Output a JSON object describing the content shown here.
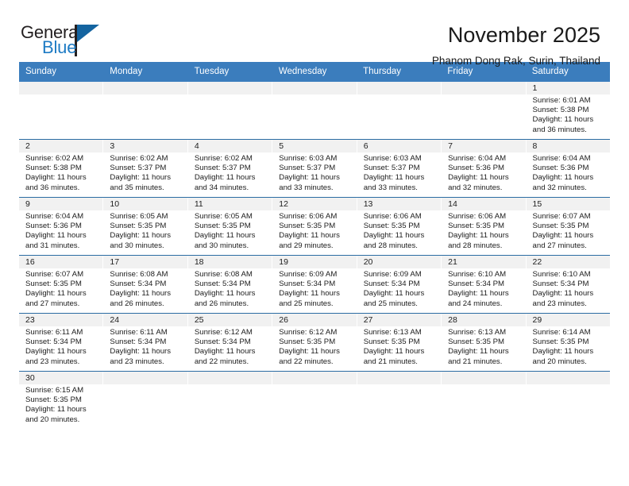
{
  "brand": {
    "name_top": "General",
    "name_bottom": "Blue",
    "accent_color": "#1e7bc4",
    "triangle_color": "#1464a0"
  },
  "header": {
    "title": "November 2025",
    "subtitle": "Phanom Dong Rak, Surin, Thailand"
  },
  "theme": {
    "header_row_bg": "#3b7dbd",
    "header_row_text": "#ffffff",
    "daynum_band_bg": "#f1f1f1",
    "week_divider": "#2b6ca3"
  },
  "weekdays": [
    "Sunday",
    "Monday",
    "Tuesday",
    "Wednesday",
    "Thursday",
    "Friday",
    "Saturday"
  ],
  "calendar_data": {
    "month": "November",
    "year": 2025,
    "location": "Phanom Dong Rak, Surin, Thailand",
    "weeks": [
      [
        {
          "day": ""
        },
        {
          "day": ""
        },
        {
          "day": ""
        },
        {
          "day": ""
        },
        {
          "day": ""
        },
        {
          "day": ""
        },
        {
          "day": "1",
          "sunrise": "Sunrise: 6:01 AM",
          "sunset": "Sunset: 5:38 PM",
          "daylight1": "Daylight: 11 hours",
          "daylight2": "and 36 minutes."
        }
      ],
      [
        {
          "day": "2",
          "sunrise": "Sunrise: 6:02 AM",
          "sunset": "Sunset: 5:38 PM",
          "daylight1": "Daylight: 11 hours",
          "daylight2": "and 36 minutes."
        },
        {
          "day": "3",
          "sunrise": "Sunrise: 6:02 AM",
          "sunset": "Sunset: 5:37 PM",
          "daylight1": "Daylight: 11 hours",
          "daylight2": "and 35 minutes."
        },
        {
          "day": "4",
          "sunrise": "Sunrise: 6:02 AM",
          "sunset": "Sunset: 5:37 PM",
          "daylight1": "Daylight: 11 hours",
          "daylight2": "and 34 minutes."
        },
        {
          "day": "5",
          "sunrise": "Sunrise: 6:03 AM",
          "sunset": "Sunset: 5:37 PM",
          "daylight1": "Daylight: 11 hours",
          "daylight2": "and 33 minutes."
        },
        {
          "day": "6",
          "sunrise": "Sunrise: 6:03 AM",
          "sunset": "Sunset: 5:37 PM",
          "daylight1": "Daylight: 11 hours",
          "daylight2": "and 33 minutes."
        },
        {
          "day": "7",
          "sunrise": "Sunrise: 6:04 AM",
          "sunset": "Sunset: 5:36 PM",
          "daylight1": "Daylight: 11 hours",
          "daylight2": "and 32 minutes."
        },
        {
          "day": "8",
          "sunrise": "Sunrise: 6:04 AM",
          "sunset": "Sunset: 5:36 PM",
          "daylight1": "Daylight: 11 hours",
          "daylight2": "and 32 minutes."
        }
      ],
      [
        {
          "day": "9",
          "sunrise": "Sunrise: 6:04 AM",
          "sunset": "Sunset: 5:36 PM",
          "daylight1": "Daylight: 11 hours",
          "daylight2": "and 31 minutes."
        },
        {
          "day": "10",
          "sunrise": "Sunrise: 6:05 AM",
          "sunset": "Sunset: 5:35 PM",
          "daylight1": "Daylight: 11 hours",
          "daylight2": "and 30 minutes."
        },
        {
          "day": "11",
          "sunrise": "Sunrise: 6:05 AM",
          "sunset": "Sunset: 5:35 PM",
          "daylight1": "Daylight: 11 hours",
          "daylight2": "and 30 minutes."
        },
        {
          "day": "12",
          "sunrise": "Sunrise: 6:06 AM",
          "sunset": "Sunset: 5:35 PM",
          "daylight1": "Daylight: 11 hours",
          "daylight2": "and 29 minutes."
        },
        {
          "day": "13",
          "sunrise": "Sunrise: 6:06 AM",
          "sunset": "Sunset: 5:35 PM",
          "daylight1": "Daylight: 11 hours",
          "daylight2": "and 28 minutes."
        },
        {
          "day": "14",
          "sunrise": "Sunrise: 6:06 AM",
          "sunset": "Sunset: 5:35 PM",
          "daylight1": "Daylight: 11 hours",
          "daylight2": "and 28 minutes."
        },
        {
          "day": "15",
          "sunrise": "Sunrise: 6:07 AM",
          "sunset": "Sunset: 5:35 PM",
          "daylight1": "Daylight: 11 hours",
          "daylight2": "and 27 minutes."
        }
      ],
      [
        {
          "day": "16",
          "sunrise": "Sunrise: 6:07 AM",
          "sunset": "Sunset: 5:35 PM",
          "daylight1": "Daylight: 11 hours",
          "daylight2": "and 27 minutes."
        },
        {
          "day": "17",
          "sunrise": "Sunrise: 6:08 AM",
          "sunset": "Sunset: 5:34 PM",
          "daylight1": "Daylight: 11 hours",
          "daylight2": "and 26 minutes."
        },
        {
          "day": "18",
          "sunrise": "Sunrise: 6:08 AM",
          "sunset": "Sunset: 5:34 PM",
          "daylight1": "Daylight: 11 hours",
          "daylight2": "and 26 minutes."
        },
        {
          "day": "19",
          "sunrise": "Sunrise: 6:09 AM",
          "sunset": "Sunset: 5:34 PM",
          "daylight1": "Daylight: 11 hours",
          "daylight2": "and 25 minutes."
        },
        {
          "day": "20",
          "sunrise": "Sunrise: 6:09 AM",
          "sunset": "Sunset: 5:34 PM",
          "daylight1": "Daylight: 11 hours",
          "daylight2": "and 25 minutes."
        },
        {
          "day": "21",
          "sunrise": "Sunrise: 6:10 AM",
          "sunset": "Sunset: 5:34 PM",
          "daylight1": "Daylight: 11 hours",
          "daylight2": "and 24 minutes."
        },
        {
          "day": "22",
          "sunrise": "Sunrise: 6:10 AM",
          "sunset": "Sunset: 5:34 PM",
          "daylight1": "Daylight: 11 hours",
          "daylight2": "and 23 minutes."
        }
      ],
      [
        {
          "day": "23",
          "sunrise": "Sunrise: 6:11 AM",
          "sunset": "Sunset: 5:34 PM",
          "daylight1": "Daylight: 11 hours",
          "daylight2": "and 23 minutes."
        },
        {
          "day": "24",
          "sunrise": "Sunrise: 6:11 AM",
          "sunset": "Sunset: 5:34 PM",
          "daylight1": "Daylight: 11 hours",
          "daylight2": "and 23 minutes."
        },
        {
          "day": "25",
          "sunrise": "Sunrise: 6:12 AM",
          "sunset": "Sunset: 5:34 PM",
          "daylight1": "Daylight: 11 hours",
          "daylight2": "and 22 minutes."
        },
        {
          "day": "26",
          "sunrise": "Sunrise: 6:12 AM",
          "sunset": "Sunset: 5:35 PM",
          "daylight1": "Daylight: 11 hours",
          "daylight2": "and 22 minutes."
        },
        {
          "day": "27",
          "sunrise": "Sunrise: 6:13 AM",
          "sunset": "Sunset: 5:35 PM",
          "daylight1": "Daylight: 11 hours",
          "daylight2": "and 21 minutes."
        },
        {
          "day": "28",
          "sunrise": "Sunrise: 6:13 AM",
          "sunset": "Sunset: 5:35 PM",
          "daylight1": "Daylight: 11 hours",
          "daylight2": "and 21 minutes."
        },
        {
          "day": "29",
          "sunrise": "Sunrise: 6:14 AM",
          "sunset": "Sunset: 5:35 PM",
          "daylight1": "Daylight: 11 hours",
          "daylight2": "and 20 minutes."
        }
      ],
      [
        {
          "day": "30",
          "sunrise": "Sunrise: 6:15 AM",
          "sunset": "Sunset: 5:35 PM",
          "daylight1": "Daylight: 11 hours",
          "daylight2": "and 20 minutes."
        },
        {
          "day": ""
        },
        {
          "day": ""
        },
        {
          "day": ""
        },
        {
          "day": ""
        },
        {
          "day": ""
        },
        {
          "day": ""
        }
      ]
    ]
  }
}
